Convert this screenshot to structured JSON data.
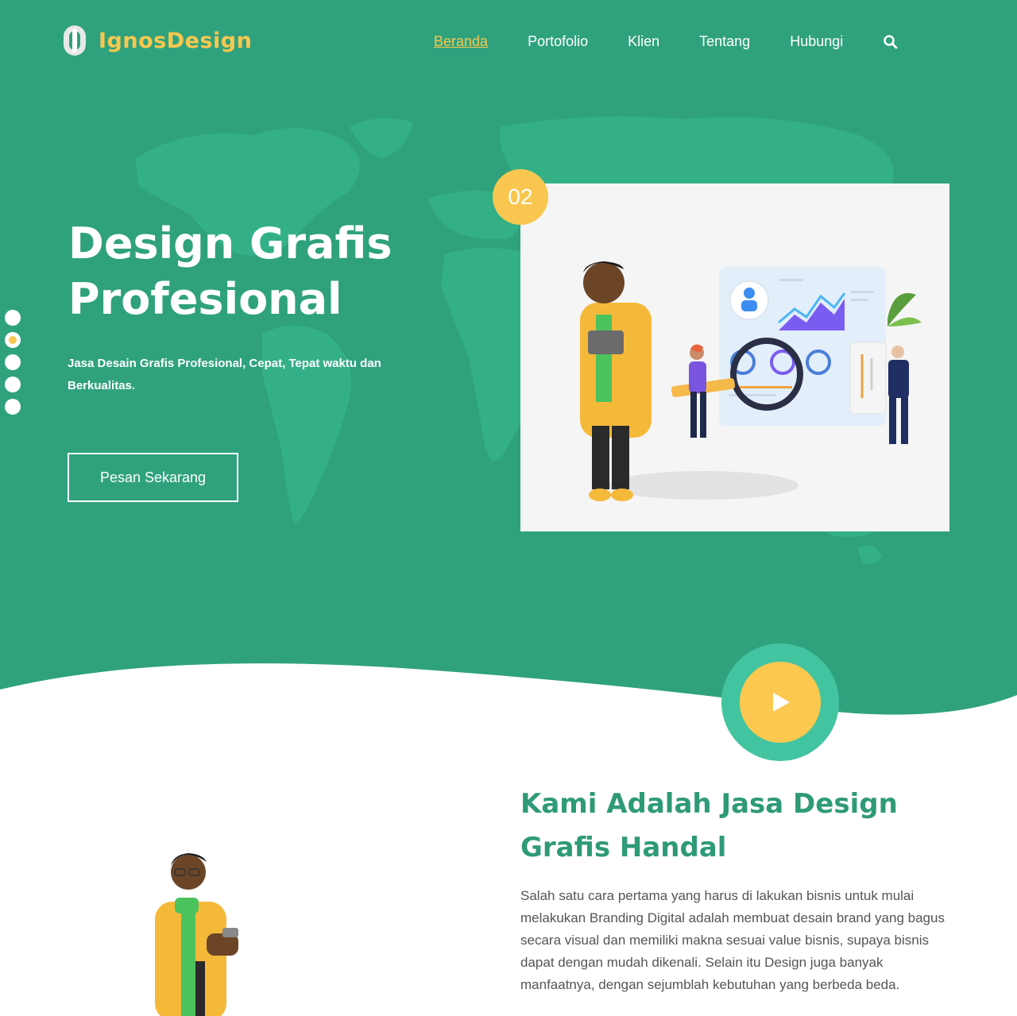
{
  "brand": {
    "name": "IgnosDesign"
  },
  "nav": {
    "items": [
      {
        "label": "Beranda",
        "active": true
      },
      {
        "label": "Portofolio",
        "active": false
      },
      {
        "label": "Klien",
        "active": false
      },
      {
        "label": "Tentang",
        "active": false
      },
      {
        "label": "Hubungi",
        "active": false
      }
    ],
    "search_icon": "search-icon"
  },
  "hero": {
    "title": "Design Grafis Profesional",
    "subtitle": "Jasa Desain Grafis Profesional, Cepat, Tepat waktu dan Berkualitas.",
    "cta_label": "Pesan Sekarang",
    "slide_number": "02",
    "slider_dots": 5,
    "active_dot": 2
  },
  "about": {
    "title": "Kami Adalah Jasa Design Grafis Handal",
    "text": "Salah satu cara pertama yang harus di lakukan bisnis untuk mulai melakukan Branding Digital adalah membuat desain brand yang bagus secara visual dan memiliki makna sesuai value bisnis, supaya bisnis dapat dengan mudah dikenali. Selain itu Design juga banyak manfaatnya, dengan sejumblah kebutuhan yang berbeda beda."
  },
  "colors": {
    "primary_green": "#2fa27d",
    "accent_yellow": "#f9c74f",
    "heading_green": "#2e9a78",
    "play_ring": "#43c4a0"
  }
}
